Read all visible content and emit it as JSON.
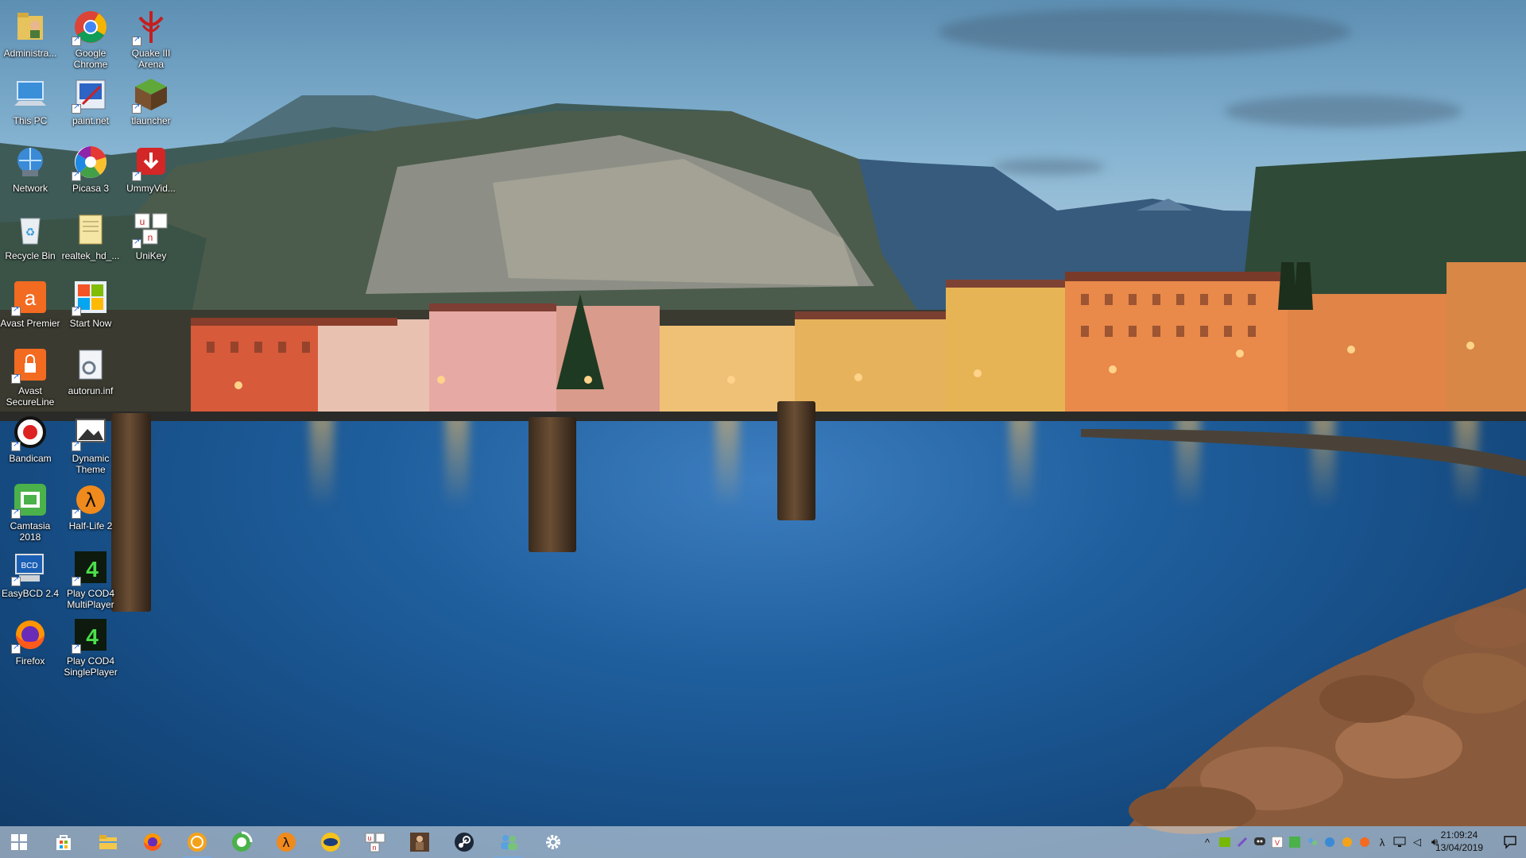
{
  "desktop": {
    "icons": [
      {
        "label": "Administra...",
        "icon": "user-folder-icon"
      },
      {
        "label": "Google Chrome",
        "icon": "chrome-icon"
      },
      {
        "label": "Quake III Arena",
        "icon": "quake-icon"
      },
      {
        "label": "This PC",
        "icon": "computer-icon"
      },
      {
        "label": "paint.net",
        "icon": "paintnet-icon"
      },
      {
        "label": "tlauncher",
        "icon": "minecraft-icon"
      },
      {
        "label": "Network",
        "icon": "network-icon"
      },
      {
        "label": "Picasa 3",
        "icon": "picasa-icon"
      },
      {
        "label": "UmmyVid...",
        "icon": "ummy-icon"
      },
      {
        "label": "Recycle Bin",
        "icon": "recycle-bin-icon"
      },
      {
        "label": "realtek_hd_...",
        "icon": "file-icon"
      },
      {
        "label": "UniKey",
        "icon": "unikey-icon"
      },
      {
        "label": "Avast Premier",
        "icon": "avast-icon"
      },
      {
        "label": "Start Now",
        "icon": "windows-xp-icon"
      },
      {
        "label": "Avast SecureLine",
        "icon": "secureline-icon"
      },
      {
        "label": "autorun.inf",
        "icon": "settings-file-icon"
      },
      {
        "label": "Bandicam",
        "icon": "bandicam-icon"
      },
      {
        "label": "Dynamic Theme",
        "icon": "dynamic-theme-icon"
      },
      {
        "label": "Camtasia 2018",
        "icon": "camtasia-icon"
      },
      {
        "label": "Half-Life 2",
        "icon": "half-life-icon"
      },
      {
        "label": "EasyBCD 2.4",
        "icon": "easybcd-icon"
      },
      {
        "label": "Play COD4 MultiPlayer",
        "icon": "cod4-icon"
      },
      {
        "label": "Firefox",
        "icon": "firefox-icon"
      },
      {
        "label": "Play COD4 SinglePlayer",
        "icon": "cod4-icon"
      }
    ]
  },
  "taskbar": {
    "apps": [
      {
        "name": "start-button",
        "icon": "windows-logo-icon"
      },
      {
        "name": "store",
        "icon": "store-icon"
      },
      {
        "name": "file-explorer",
        "icon": "folder-icon"
      },
      {
        "name": "firefox",
        "icon": "firefox-icon"
      },
      {
        "name": "yellow-circle-app",
        "icon": "circle-app-icon"
      },
      {
        "name": "camtasia",
        "icon": "camtasia-icon"
      },
      {
        "name": "half-life",
        "icon": "half-life-icon"
      },
      {
        "name": "bandicam",
        "icon": "bandicam-icon"
      },
      {
        "name": "unikey",
        "icon": "unikey-icon"
      },
      {
        "name": "game",
        "icon": "game-icon"
      },
      {
        "name": "steam",
        "icon": "steam-icon"
      },
      {
        "name": "contacts",
        "icon": "people-icon"
      },
      {
        "name": "settings",
        "icon": "gear-icon"
      }
    ],
    "clock": {
      "time": "21:09:24",
      "date": "13/04/2019"
    },
    "accent": "#7aa7d8"
  }
}
